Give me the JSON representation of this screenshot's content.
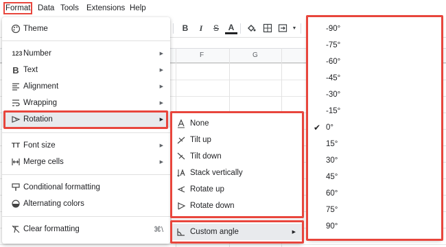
{
  "menubar": {
    "items": [
      "Format",
      "Data",
      "Tools",
      "Extensions",
      "Help"
    ]
  },
  "toolbar": {
    "bold": "B",
    "italic": "I",
    "strike": "S",
    "text_color": "A"
  },
  "sheet": {
    "columns": [
      "F",
      "G"
    ]
  },
  "format_menu": {
    "theme": "Theme",
    "number": "Number",
    "text": "Text",
    "alignment": "Alignment",
    "wrapping": "Wrapping",
    "rotation": "Rotation",
    "font_size": "Font size",
    "merge_cells": "Merge cells",
    "conditional_formatting": "Conditional formatting",
    "alternating_colors": "Alternating colors",
    "clear_formatting": "Clear formatting",
    "clear_formatting_shortcut": "⌘\\",
    "number_icon": "123"
  },
  "rotation_menu": {
    "items": [
      "None",
      "Tilt up",
      "Tilt down",
      "Stack vertically",
      "Rotate up",
      "Rotate down"
    ],
    "custom_angle": "Custom angle"
  },
  "angle_menu": {
    "items": [
      "-90°",
      "-75°",
      "-60°",
      "-45°",
      "-30°",
      "-15°",
      "0°",
      "15°",
      "30°",
      "45°",
      "60°",
      "75°",
      "90°"
    ],
    "selected": "0°"
  },
  "colors": {
    "highlight": "#e8453c",
    "menu_hover": "#e8eaed"
  }
}
